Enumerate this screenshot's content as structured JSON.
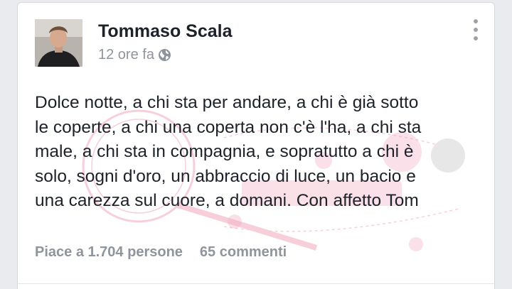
{
  "post": {
    "author": "Tommaso Scala",
    "time": "12 ore fa",
    "privacy_icon": "globe-icon",
    "text_lines": [
      "Dolce notte, a chi sta per andare, a chi è già sotto",
      "le coperte, a chi una coperta non c'è l'ha, a chi sta",
      "male, a chi sta in compagnia, e sopratutto a chi è",
      "solo, sogni d'oro, un abbraccio di luce, un bacio e",
      "una carezza sul cuore, a domani. Con affetto Tom"
    ],
    "likes": "Piace a 1.704 persone",
    "comments": "65 commenti"
  },
  "colors": {
    "name": "#1d2129",
    "meta": "#90949c",
    "watermark": "#f2a9be"
  }
}
